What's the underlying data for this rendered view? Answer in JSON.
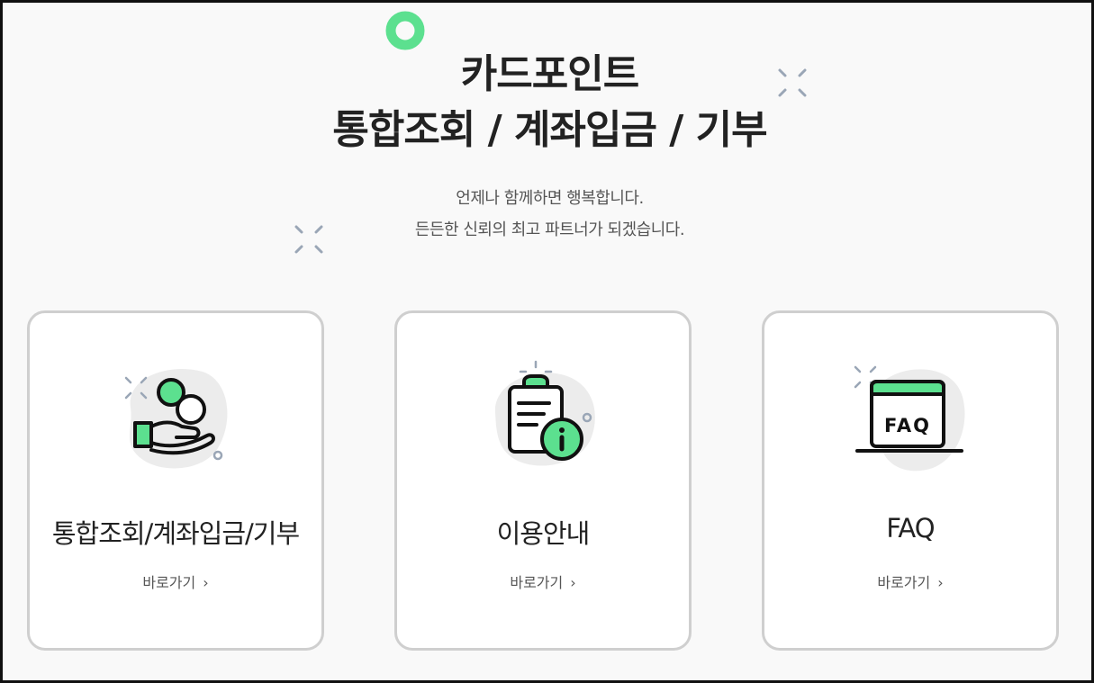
{
  "header": {
    "title_line1": "카드포인트",
    "title_line2": "통합조회 / 계좌입금 / 기부",
    "subtitle_line1": "언제나 함께하면 행복합니다.",
    "subtitle_line2": "든든한 신뢰의 최고 파트너가 되겠습니다."
  },
  "colors": {
    "accent_green": "#3ddc84",
    "decor_gray": "#9aa6b6",
    "card_border": "#cfcfcf"
  },
  "cards": [
    {
      "title": "통합조회/계좌입금/기부",
      "link_label": "바로가기",
      "link_icon": "›",
      "icon": "coin-hand-icon"
    },
    {
      "title": "이용안내",
      "link_label": "바로가기",
      "link_icon": "›",
      "icon": "clipboard-info-icon"
    },
    {
      "title": "FAQ",
      "link_label": "바로가기",
      "link_icon": "›",
      "icon": "faq-window-icon",
      "icon_text": "FAQ"
    }
  ]
}
